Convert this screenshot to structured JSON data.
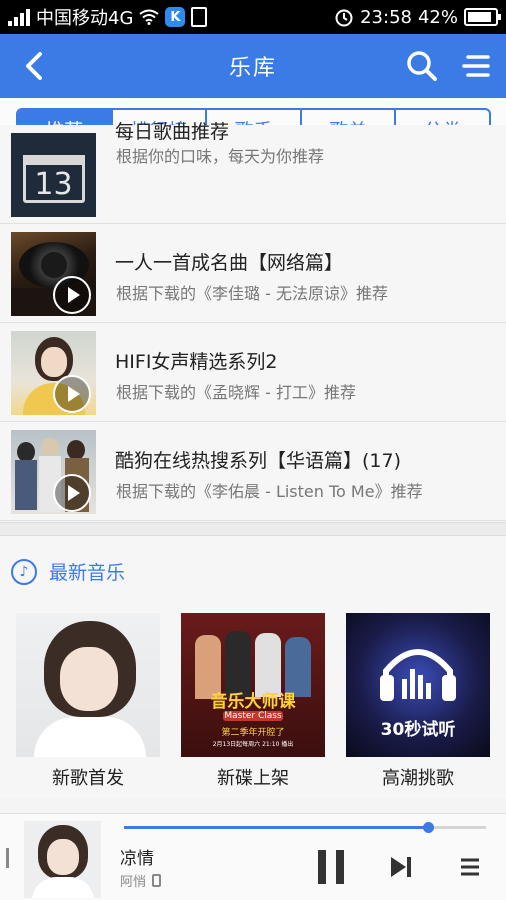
{
  "status_bar": {
    "carrier": "中国移动4G",
    "badge_letter": "K",
    "time": "23:58",
    "battery": "42%"
  },
  "header": {
    "title": "乐库"
  },
  "tabs": [
    {
      "label": "推荐",
      "active": true
    },
    {
      "label": "排行榜",
      "active": false
    },
    {
      "label": "歌手",
      "active": false
    },
    {
      "label": "歌单",
      "active": false
    },
    {
      "label": "分类",
      "active": false
    }
  ],
  "playlists": [
    {
      "calendar_day": "13",
      "title": "每日歌曲推荐",
      "subtitle": "根据你的口味，每天为你推荐"
    },
    {
      "title": "一人一首成名曲【网络篇】",
      "subtitle": "根据下载的《李佳璐 - 无法原谅》推荐"
    },
    {
      "title": "HIFI女声精选系列2",
      "subtitle": "根据下载的《孟晓辉 - 打工》推荐"
    },
    {
      "title": "酷狗在线热搜系列【华语篇】(17)",
      "subtitle": "根据下载的《李佑晨 - Listen To Me》推荐"
    }
  ],
  "section": {
    "icon": "music-note-icon",
    "title": "最新音乐",
    "cards": [
      {
        "caption": "新歌首发"
      },
      {
        "caption": "新碟上架",
        "art_text": "音乐大师课",
        "art_sub": "Master Class",
        "art_banner": "第二季年开腔了",
        "art_date": "2月13日起每周六 21:10 播出"
      },
      {
        "caption": "高潮挑歌",
        "art_text": "30秒试听"
      }
    ]
  },
  "player": {
    "song": "凉情",
    "artist": "阿悄",
    "progress": 0.84
  },
  "colors": {
    "accent": "#3b7be6"
  }
}
